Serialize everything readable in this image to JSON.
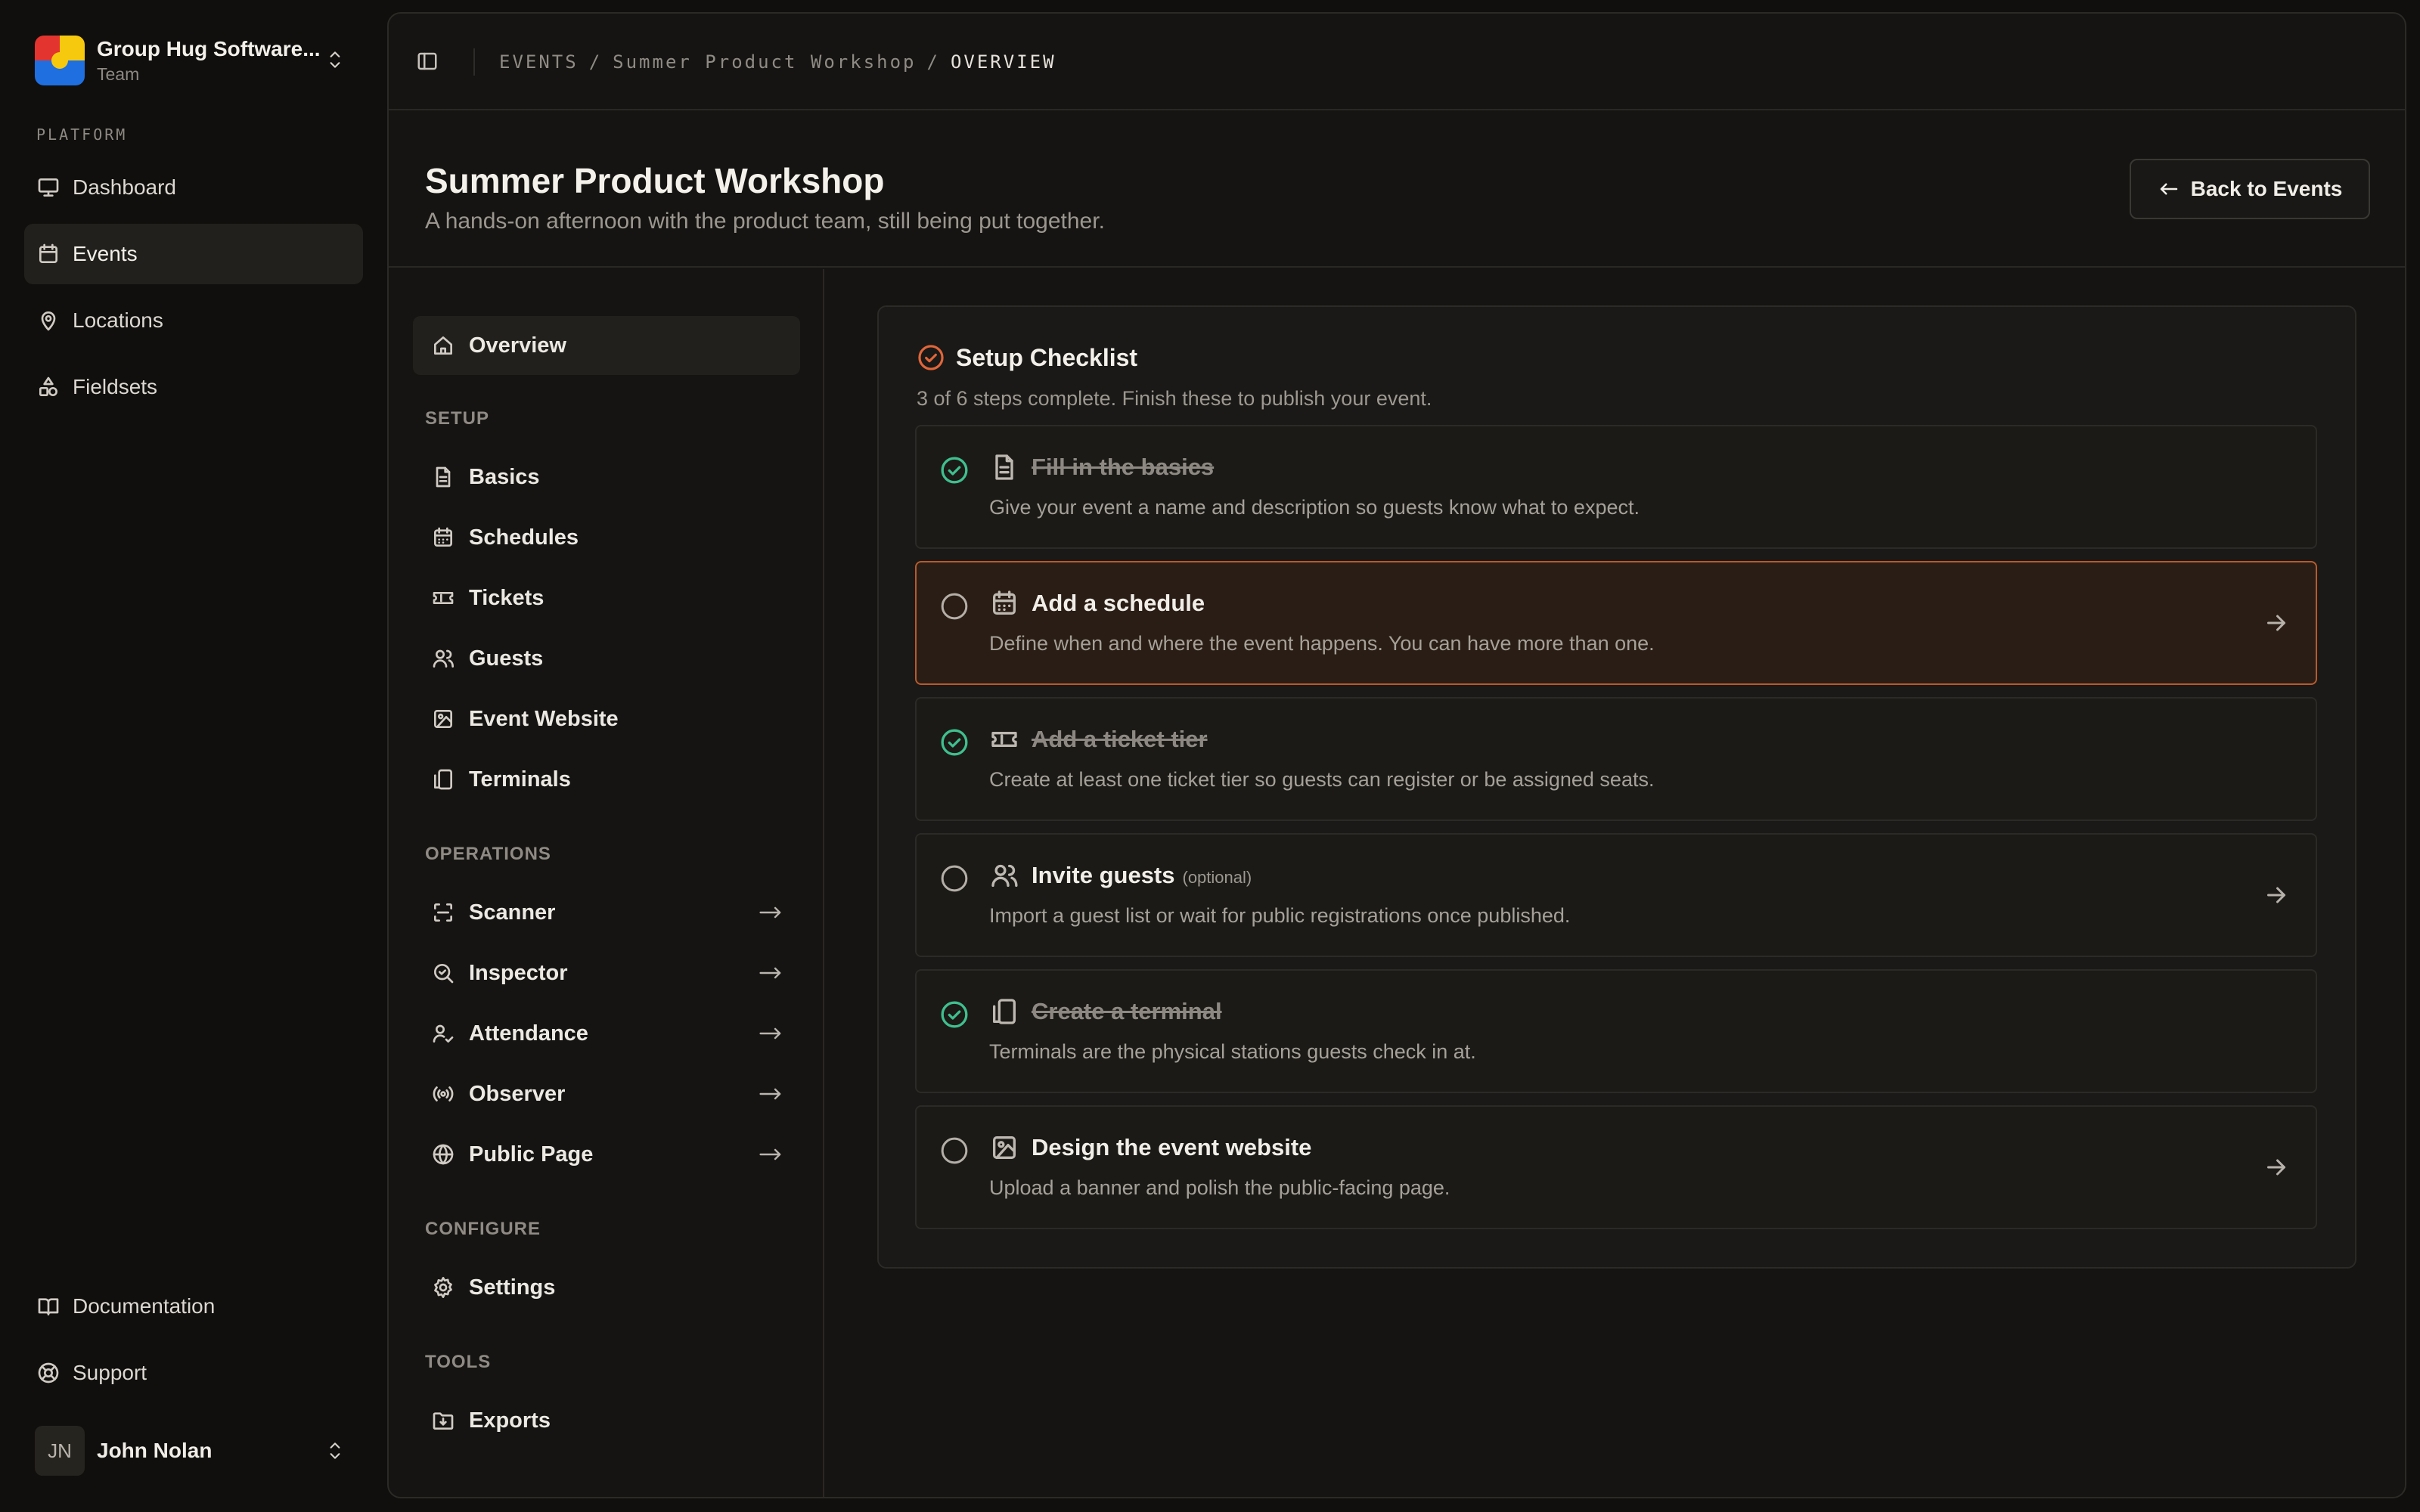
{
  "colors": {
    "background": "#100f0d",
    "panel": "#151412",
    "accent": "#e0663a",
    "success": "#3fbf8f",
    "highlight_border": "#b85a2a"
  },
  "org": {
    "name": "Group Hug Software...",
    "subtitle": "Team"
  },
  "sidebar": {
    "section_label": "PLATFORM",
    "items": [
      {
        "label": "Dashboard",
        "icon": "monitor-icon"
      },
      {
        "label": "Events",
        "icon": "calendar-icon",
        "active": true
      },
      {
        "label": "Locations",
        "icon": "map-pin-icon"
      },
      {
        "label": "Fieldsets",
        "icon": "shapes-icon"
      }
    ],
    "footer_items": [
      {
        "label": "Documentation",
        "icon": "book-icon"
      },
      {
        "label": "Support",
        "icon": "life-buoy-icon"
      }
    ],
    "user": {
      "initials": "JN",
      "name": "John Nolan"
    }
  },
  "breadcrumb": [
    "EVENTS",
    "Summer Product Workshop",
    "OVERVIEW"
  ],
  "header": {
    "title": "Summer Product Workshop",
    "subtitle": "A hands-on afternoon with the product team, still being put together.",
    "back_label": "Back to Events"
  },
  "event_nav": {
    "overview": "Overview",
    "setup_label": "SETUP",
    "setup": [
      "Basics",
      "Schedules",
      "Tickets",
      "Guests",
      "Event Website",
      "Terminals"
    ],
    "operations_label": "OPERATIONS",
    "operations": [
      "Scanner",
      "Inspector",
      "Attendance",
      "Observer",
      "Public Page"
    ],
    "configure_label": "CONFIGURE",
    "configure": [
      "Settings"
    ],
    "tools_label": "TOOLS",
    "tools": [
      "Exports"
    ]
  },
  "checklist": {
    "title": "Setup Checklist",
    "description": "3 of 6 steps complete. Finish these to publish your event.",
    "completed": 3,
    "total": 6,
    "steps": [
      {
        "title": "Fill in the basics",
        "description": "Give your event a name and description so guests know what to expect.",
        "done": true,
        "icon": "file-text-icon"
      },
      {
        "title": "Add a schedule",
        "description": "Define when and where the event happens. You can have more than one.",
        "done": false,
        "icon": "calendar-icon"
      },
      {
        "title": "Add a ticket tier",
        "description": "Create at least one ticket tier so guests can register or be assigned seats.",
        "done": true,
        "icon": "ticket-icon"
      },
      {
        "title": "Invite guests",
        "optional": "(optional)",
        "description": "Import a guest list or wait for public registrations once published.",
        "done": false,
        "icon": "users-icon"
      },
      {
        "title": "Create a terminal",
        "description": "Terminals are the physical stations guests check in at.",
        "done": true,
        "icon": "tablet-icon"
      },
      {
        "title": "Design the event website",
        "description": "Upload a banner and polish the public-facing page.",
        "done": false,
        "icon": "image-icon"
      }
    ]
  }
}
